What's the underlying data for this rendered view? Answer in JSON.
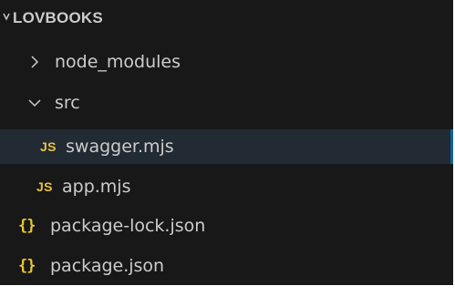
{
  "explorer": {
    "project_name": "LOVBOOKS",
    "items": [
      {
        "label": "node_modules",
        "type": "folder",
        "expanded": false
      },
      {
        "label": "src",
        "type": "folder",
        "expanded": true
      },
      {
        "label": "swagger.mjs",
        "type": "file",
        "icon_text": "JS",
        "selected": true
      },
      {
        "label": "app.mjs",
        "type": "file",
        "icon_text": "JS"
      },
      {
        "label": "package-lock.json",
        "type": "file",
        "icon_text": "{}"
      },
      {
        "label": "package.json",
        "type": "file",
        "icon_text": "{}"
      }
    ]
  },
  "colors": {
    "background": "#181818",
    "text": "#cccccc",
    "js_icon": "#e8c33d",
    "json_icon": "#e6c63a",
    "selection_bg": "#222a33",
    "selection_border": "#0e639c"
  },
  "icons": {
    "collapsed": "chevron-right-icon",
    "expanded": "chevron-down-icon",
    "js": "js-file-icon",
    "json": "json-file-icon"
  }
}
